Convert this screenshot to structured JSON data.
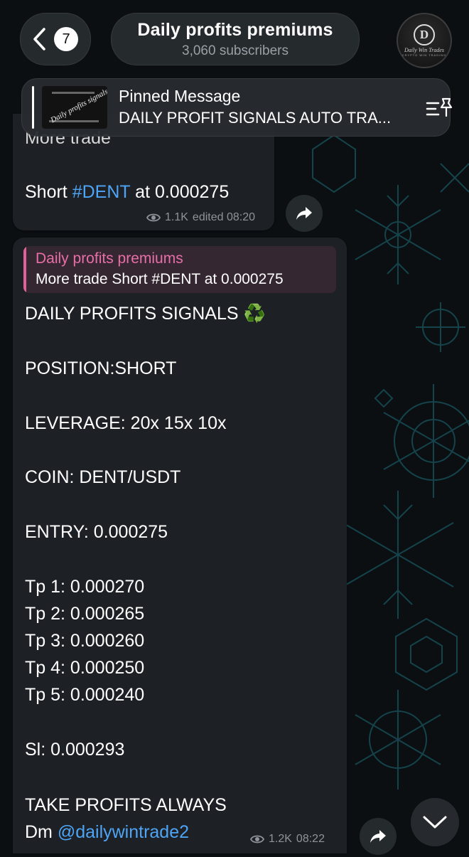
{
  "header": {
    "unread_count": "7",
    "channel_name": "Daily profits premiums",
    "subscribers": "3,060 subscribers",
    "avatar_letter": "D",
    "avatar_name": "Daily Win Trades",
    "avatar_sub": "CRYPTO WIN TRADING"
  },
  "pinned": {
    "title": "Pinned Message",
    "text": "DAILY PROFIT SIGNALS AUTO TRA...",
    "thumb_text": "Daily profits signals"
  },
  "message1": {
    "more": "More trade",
    "prefix": "Short ",
    "tag": "#DENT",
    "suffix": " at 0.000275",
    "views": "1.1K",
    "time": "edited 08:20"
  },
  "message2": {
    "reply_name": "Daily profits premiums",
    "reply_text": "More trade Short #DENT at 0.000275",
    "lines": [
      "DAILY PROFITS SIGNALS ♻️",
      "POSITION:SHORT",
      "LEVERAGE: 20x 15x 10x",
      "COIN: DENT/USDT",
      "ENTRY: 0.000275",
      "Tp 1:  0.000270",
      "Tp 2:  0.000265",
      "Tp 3: 0.000260",
      "Tp 4: 0.000250",
      "Tp 5: 0.000240",
      "Sl: 0.000293",
      "TAKE  PROFITS ALWAYS"
    ],
    "dm_prefix": "Dm ",
    "dm_handle": "@dailywintrade2",
    "views": "1.2K",
    "time": "08:22"
  },
  "icons": {
    "back": "chevron-left-icon",
    "pin": "pin-list-icon",
    "views": "eye-icon",
    "share": "forward-icon",
    "scroll": "chevron-down-icon"
  },
  "colors": {
    "accent_link": "#4ea4f5",
    "reply_name": "#e86ea6",
    "bubble": "#1d2024",
    "background": "#0b0f12"
  }
}
